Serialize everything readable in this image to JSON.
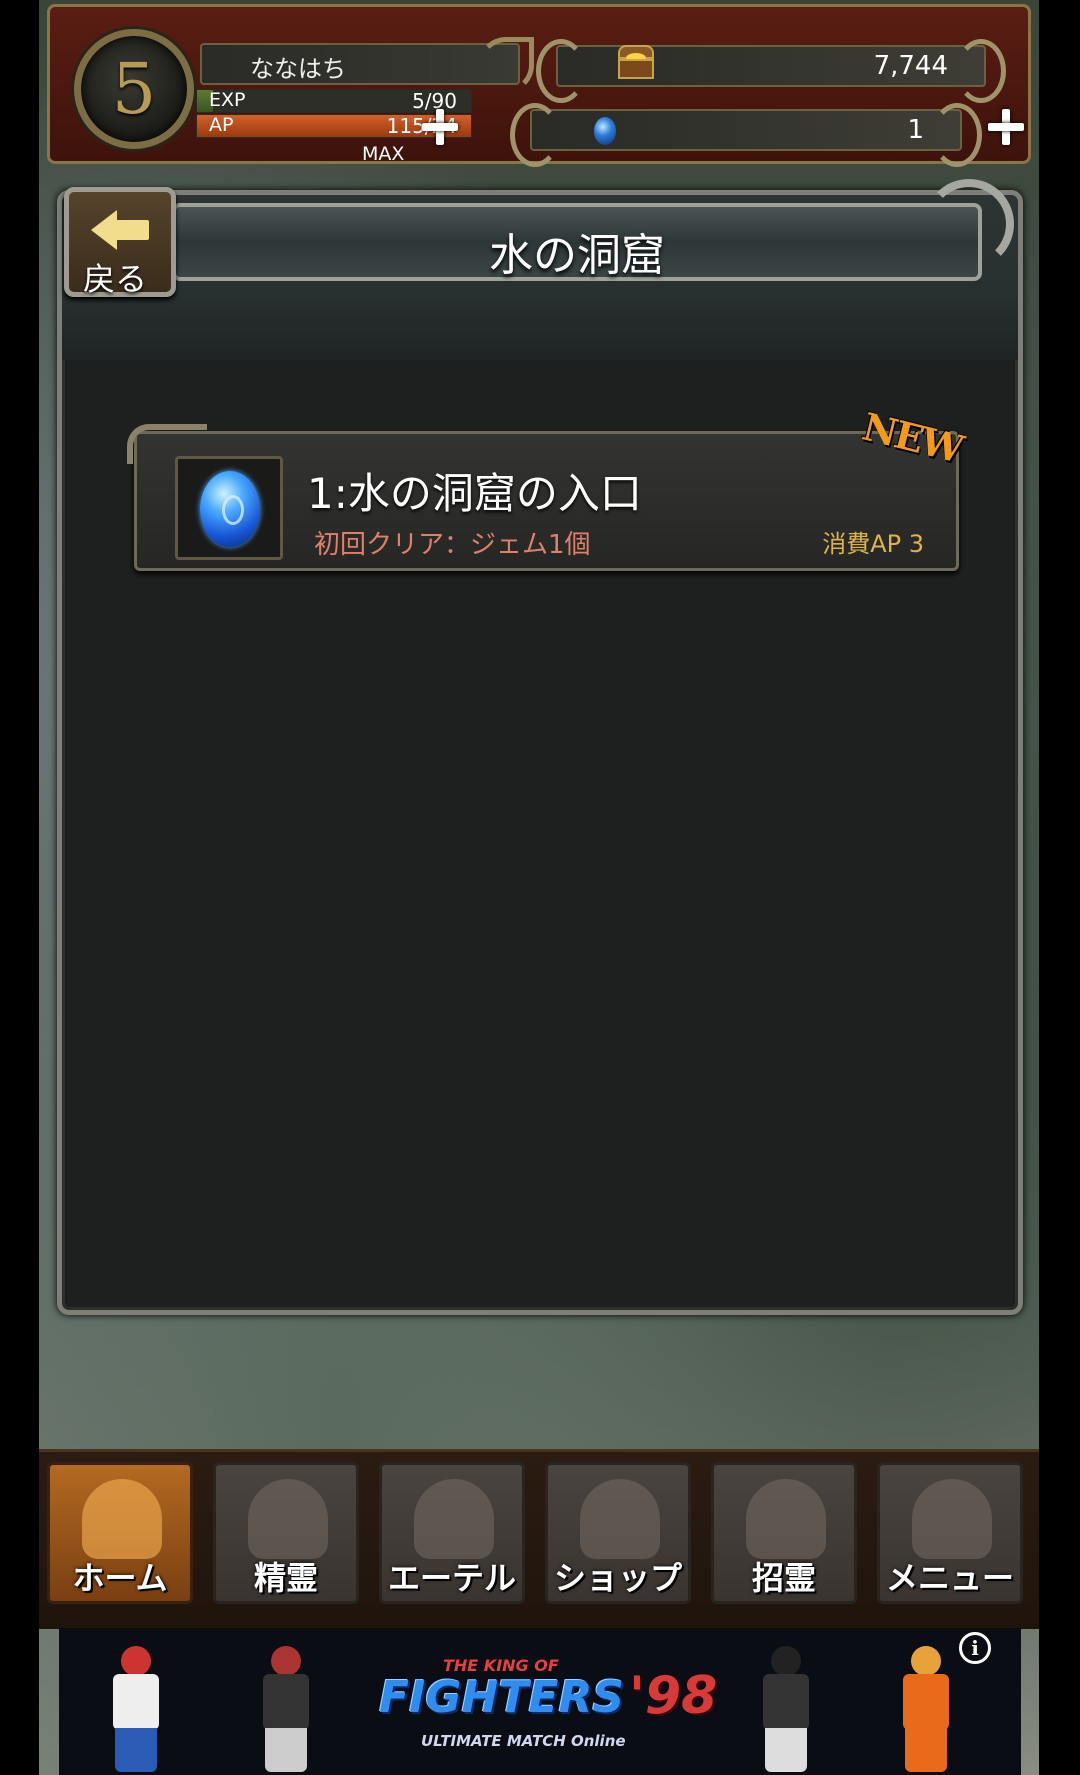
{
  "player": {
    "level": "5",
    "name": "ななはち",
    "exp_label": "EXP",
    "exp_value": "5/90",
    "exp_fraction": 0.06,
    "ap_label": "AP",
    "ap_value": "115/24",
    "ap_fraction": 1.0,
    "max_label": "MAX"
  },
  "currency": {
    "gold": "7,744",
    "gems": "1"
  },
  "header": {
    "title": "水の洞窟",
    "back_label": "戻る"
  },
  "stages": [
    {
      "title": "1:水の洞窟の入口",
      "first_clear": "初回クリア：ジェム1個",
      "cost": "消費AP 3",
      "badge": "NEW"
    }
  ],
  "nav": {
    "items": [
      {
        "label": "ホーム",
        "icon": "helmet-icon",
        "active": true
      },
      {
        "label": "精霊",
        "icon": "spirit-icon",
        "active": false
      },
      {
        "label": "エーテル",
        "icon": "ring-icon",
        "active": false
      },
      {
        "label": "ショップ",
        "icon": "bag-icon",
        "active": false
      },
      {
        "label": "招霊",
        "icon": "ankh-icon",
        "active": false
      },
      {
        "label": "メニュー",
        "icon": "hand-icon",
        "active": false
      }
    ]
  },
  "banner": {
    "logo_top": "THE KING OF",
    "logo_main": "FIGHTERS",
    "logo_num": "'98",
    "logo_sub": "ULTIMATE MATCH Online",
    "info": "i"
  },
  "colors": {
    "accent_orange": "#b36a22",
    "cost_gold": "#e0b24a",
    "sub_red": "#e07f6a",
    "new_orange": "#f29a1a"
  }
}
